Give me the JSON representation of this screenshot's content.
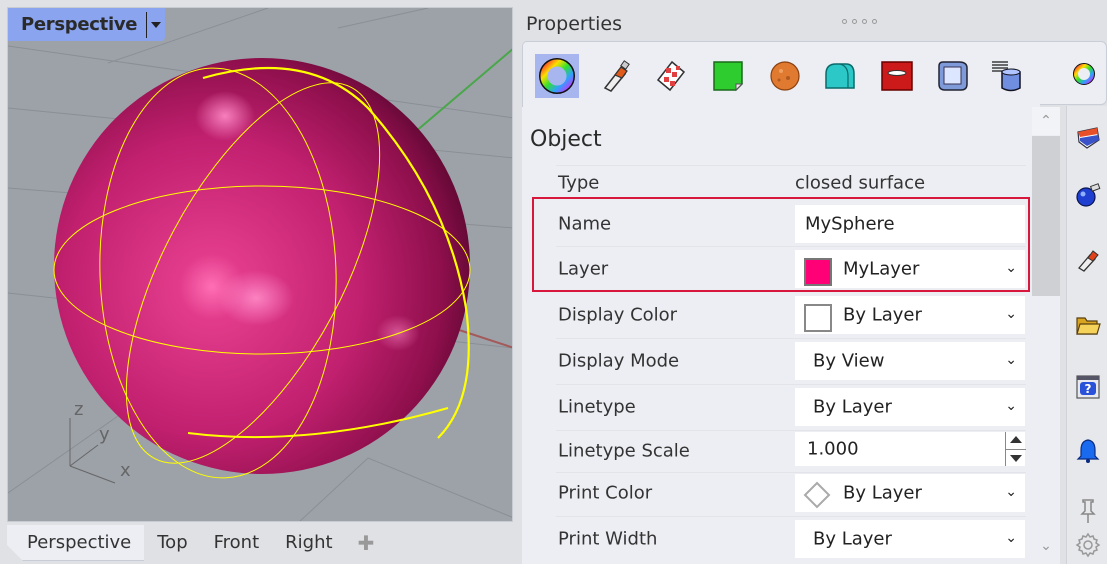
{
  "viewport": {
    "title": "Perspective",
    "axis_labels": {
      "x": "x",
      "y": "y",
      "z": "z"
    },
    "colors": {
      "background": "#9da2a9",
      "sphere": "#c1206f",
      "isocurves": "#ffff00",
      "x_axis": "#a35a5a",
      "y_axis": "#4aa64a"
    }
  },
  "view_tabs": [
    {
      "label": "Perspective",
      "active": true
    },
    {
      "label": "Top",
      "active": false
    },
    {
      "label": "Front",
      "active": false
    },
    {
      "label": "Right",
      "active": false
    }
  ],
  "view_tabs_add": "✚",
  "properties": {
    "title": "Properties",
    "toolbar_icons": [
      {
        "name": "object-properties-icon",
        "selected": true
      },
      {
        "name": "material-icon",
        "selected": false
      },
      {
        "name": "texture-mapping-icon",
        "selected": false
      },
      {
        "name": "decals-icon",
        "selected": false
      },
      {
        "name": "displacement-icon",
        "selected": false
      },
      {
        "name": "edge-softening-icon",
        "selected": false
      },
      {
        "name": "shut-lining-icon",
        "selected": false
      },
      {
        "name": "thickening-icon",
        "selected": false
      },
      {
        "name": "attribute-user-text-icon",
        "selected": false
      }
    ],
    "section": "Object",
    "rows": [
      {
        "label": "Type",
        "value": "closed surface",
        "kind": "static"
      },
      {
        "label": "Name",
        "value": "MySphere",
        "kind": "text"
      },
      {
        "label": "Layer",
        "value": "MyLayer",
        "kind": "dropdown",
        "swatch": "#ff0077"
      },
      {
        "label": "Display Color",
        "value": "By Layer",
        "kind": "dropdown",
        "swatch": "#ffffff"
      },
      {
        "label": "Display Mode",
        "value": "By View",
        "kind": "dropdown"
      },
      {
        "label": "Linetype",
        "value": "By Layer",
        "kind": "dropdown"
      },
      {
        "label": "Linetype Scale",
        "value": "1.000",
        "kind": "spinner"
      },
      {
        "label": "Print Color",
        "value": "By Layer",
        "kind": "dropdown",
        "swatch": "diamond"
      },
      {
        "label": "Print Width",
        "value": "By Layer",
        "kind": "dropdown"
      }
    ],
    "highlight_color": "#d8173c"
  },
  "side_panel_icons": [
    "color-wheel-icon",
    "layers-icon",
    "render-icon",
    "materials-icon",
    "files-icon",
    "help-icon",
    "notifications-icon",
    "pin-icon",
    "settings-icon"
  ]
}
